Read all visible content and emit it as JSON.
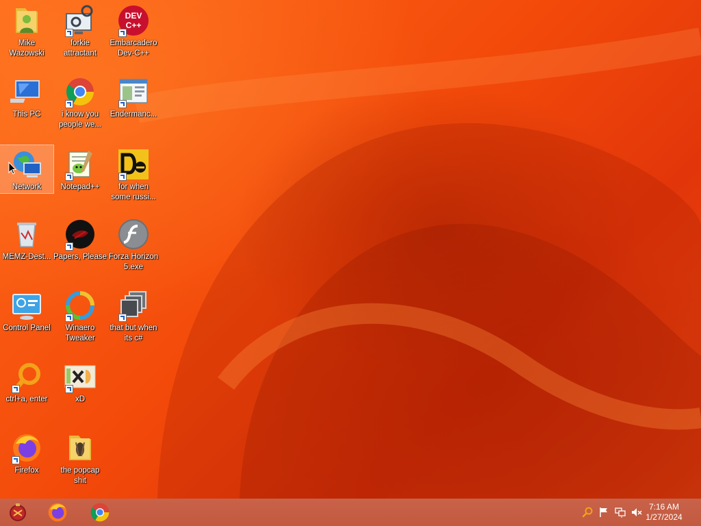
{
  "desktop": {
    "icons": [
      {
        "id": "mike",
        "label": "Mike\nWazowski"
      },
      {
        "id": "forkie",
        "label": "forkie\nattractant"
      },
      {
        "id": "devcpp",
        "label": "Embarcadero\nDev-C++"
      },
      {
        "id": "thispc",
        "label": "This PC"
      },
      {
        "id": "chrome",
        "label": "i know you\npeople we..."
      },
      {
        "id": "enderman",
        "label": "Endermanc..."
      },
      {
        "id": "network",
        "label": "Network"
      },
      {
        "id": "notepadpp",
        "label": "Notepad++"
      },
      {
        "id": "russian",
        "label": "for when\nsome russi..."
      },
      {
        "id": "memz",
        "label": "MEMZ-Dest..."
      },
      {
        "id": "papers",
        "label": "Papers, Please"
      },
      {
        "id": "forza",
        "label": "Forza Horizon\n5.exe"
      },
      {
        "id": "controlpanel",
        "label": "Control Panel"
      },
      {
        "id": "winaero",
        "label": "Winaero\nTweaker"
      },
      {
        "id": "csharp",
        "label": "that but when\nits c#"
      },
      {
        "id": "ctrla",
        "label": "ctrl+a, enter"
      },
      {
        "id": "xd",
        "label": "xD"
      },
      {
        "id": "firefox",
        "label": "Firefox"
      },
      {
        "id": "popcap",
        "label": "the popcap\nshit"
      }
    ],
    "devcpp_icon_text": "DEV\nC++"
  },
  "taskbar": {
    "clock_time": "7:16 AM",
    "clock_date": "1/27/2024"
  }
}
